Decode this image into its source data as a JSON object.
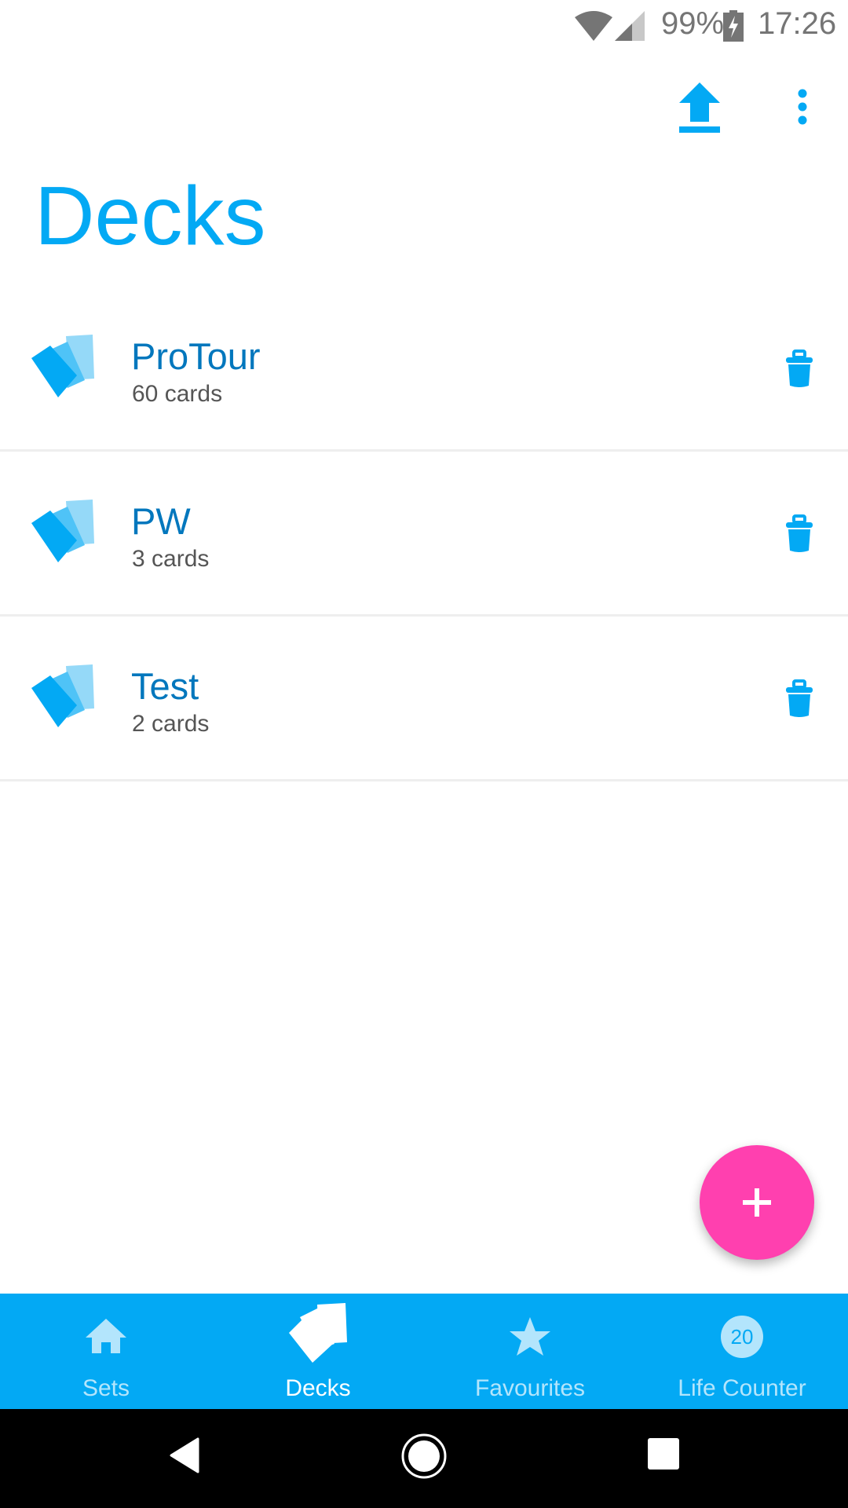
{
  "status_bar": {
    "battery_percent": "99%",
    "time": "17:26",
    "icons": [
      "wifi-icon",
      "cell-signal-icon",
      "battery-charging-icon"
    ]
  },
  "toolbar": {
    "upload_icon": "upload-icon",
    "more_icon": "more-vert-icon"
  },
  "page": {
    "title": "Decks"
  },
  "decks": [
    {
      "name": "ProTour",
      "count": "60 cards"
    },
    {
      "name": "PW",
      "count": "3 cards"
    },
    {
      "name": "Test",
      "count": "2 cards"
    }
  ],
  "fab": {
    "icon": "plus-icon",
    "color": "#FF40AF"
  },
  "bottom_nav": {
    "active": "Decks",
    "items": [
      {
        "label": "Sets",
        "icon": "home-icon"
      },
      {
        "label": "Decks",
        "icon": "cards-icon"
      },
      {
        "label": "Favourites",
        "icon": "star-icon"
      },
      {
        "label": "Life Counter",
        "icon": "life-counter-icon",
        "badge": "20"
      }
    ]
  },
  "colors": {
    "accent": "#03A9F4",
    "deck_name": "#0277BD",
    "fab": "#FF40AF",
    "nav_inactive": "#B3E5FC"
  }
}
